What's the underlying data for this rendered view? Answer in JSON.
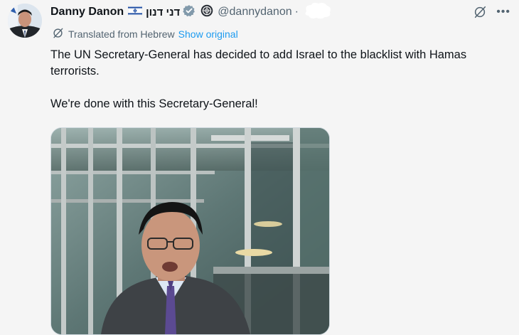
{
  "author": {
    "display_name": "Danny Danon",
    "hebrew_name": "דני דנון",
    "handle": "@dannydanon",
    "separator": "·",
    "flag_icon": "israel-flag-icon",
    "verified_icon": "verified-badge-icon",
    "verified_color": "#829aab",
    "emblem_icon": "un-emblem-icon"
  },
  "translation": {
    "label": "Translated from Hebrew",
    "show_original": "Show original",
    "icon": "grok-translate-icon"
  },
  "tweet": {
    "paragraphs": [
      "The UN Secretary-General has decided to add Israel to the blacklist with Hamas terrorists.",
      "We're done with this Secretary-General!"
    ]
  },
  "actions": {
    "grok_icon": "grok-icon",
    "more_label": "•••"
  },
  "media": {
    "type": "video-thumbnail"
  },
  "colors": {
    "background": "#f5f5f5",
    "link": "#1d9bf0",
    "secondary_text": "#536471",
    "primary_text": "#0f1419"
  }
}
